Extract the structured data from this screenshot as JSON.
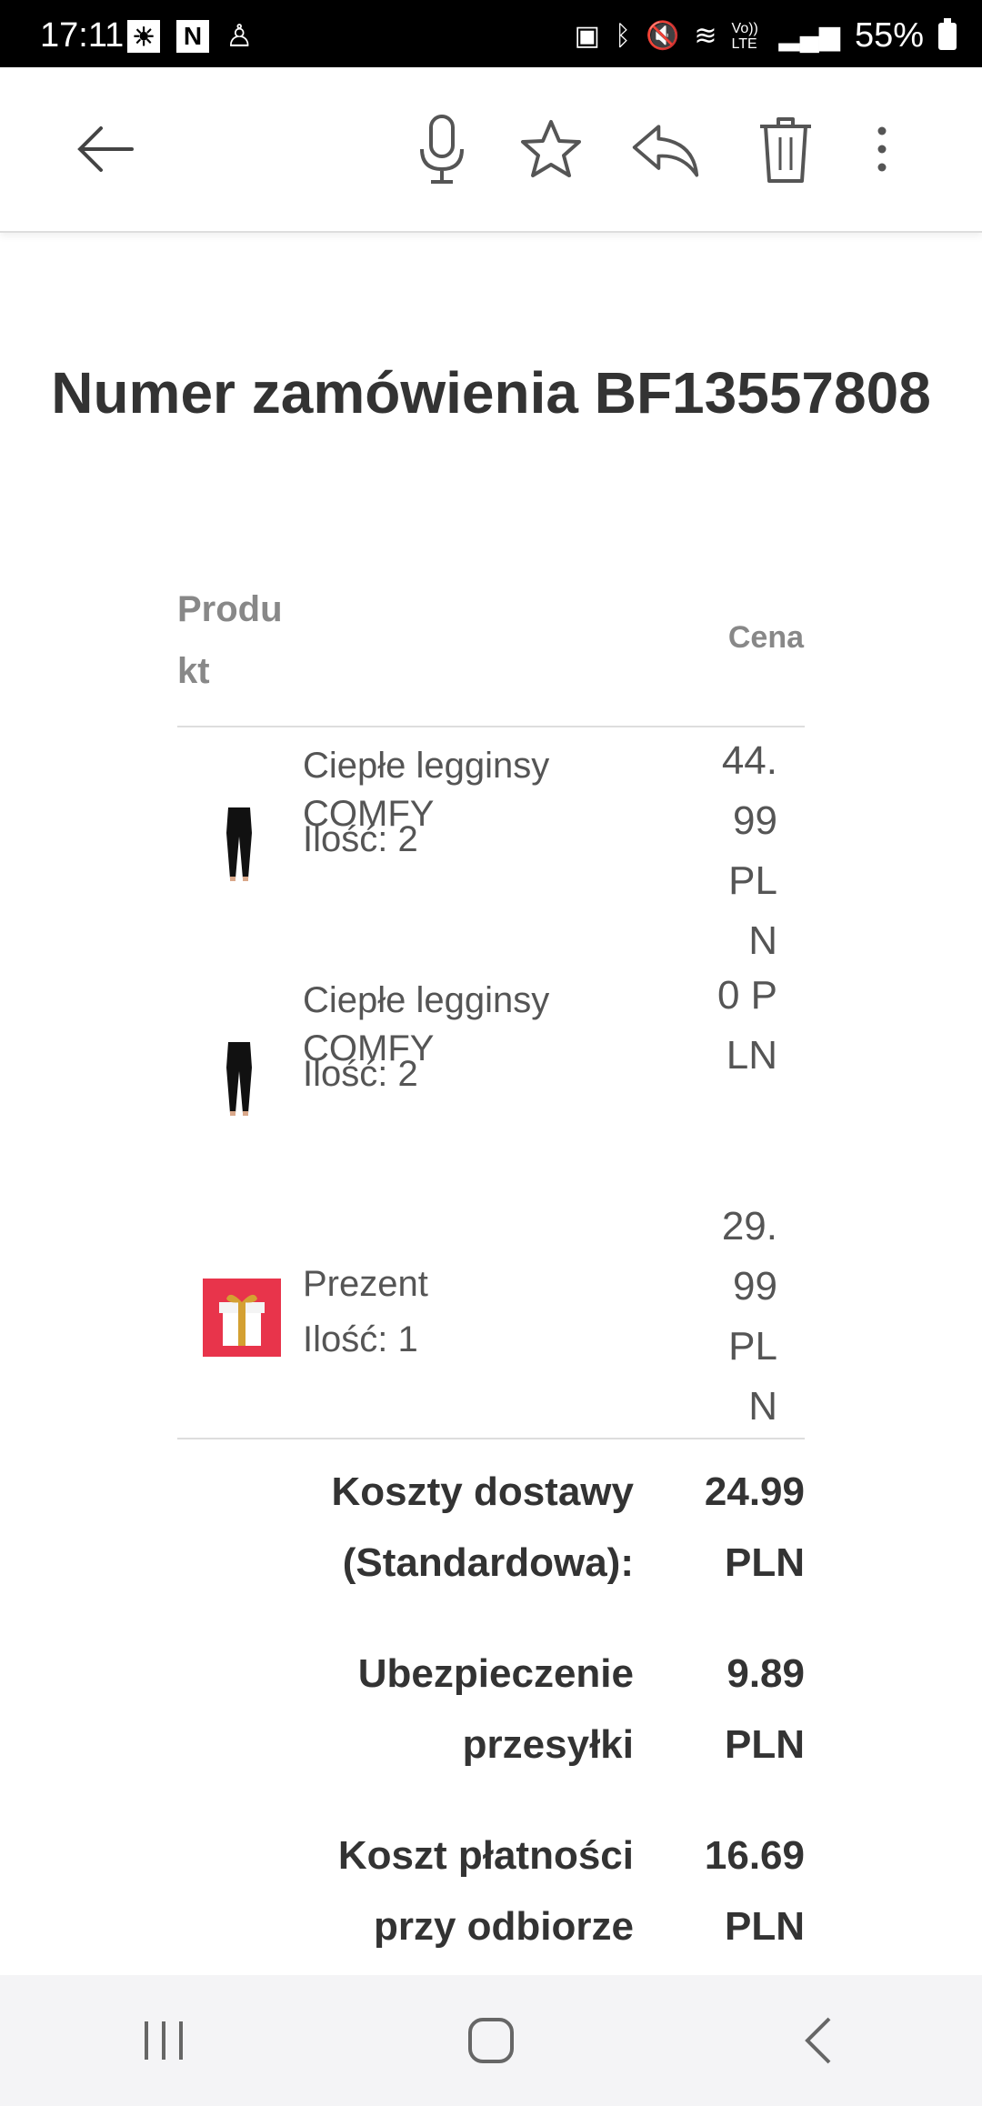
{
  "status_bar": {
    "time": "17:11",
    "netflix_letter": "N",
    "battery": "55%",
    "volte": "Vo)) LTE"
  },
  "toolbar": {
    "icons": [
      "back-arrow-icon",
      "microphone-icon",
      "star-icon",
      "reply-icon",
      "trash-icon",
      "more-options-icon"
    ]
  },
  "email": {
    "order_title": "Numer zamówienia BF13557808",
    "table": {
      "header_product": "Produkt",
      "header_price": "Cena"
    },
    "items": [
      {
        "name": "Ciepłe legginsy COMFY",
        "qty": "Ilość: 2",
        "price": "44.99 PLN",
        "thumb": "leggings"
      },
      {
        "name": "Ciepłe legginsy COMFY",
        "qty": "Ilość: 2",
        "price": "0 PLN",
        "thumb": "leggings"
      },
      {
        "name": "Prezent",
        "qty": "Ilość: 1",
        "price": "29.99 PLN",
        "thumb": "gift"
      }
    ],
    "summary": [
      {
        "label": "Koszty dostawy (Standardowa):",
        "value": "24.99 PLN"
      },
      {
        "label": "Ubezpieczenie przesyłki",
        "value": "9.89 PLN"
      },
      {
        "label": "Koszt płatności przy odbiorze",
        "value": "16.69 PLN"
      }
    ]
  },
  "nav_bar": {
    "buttons": [
      "recent-apps",
      "home",
      "back"
    ]
  }
}
